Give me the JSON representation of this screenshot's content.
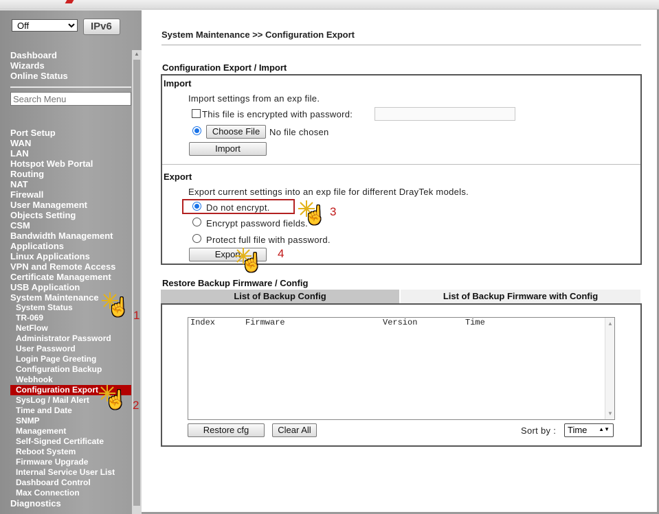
{
  "sidebar": {
    "mode_select_value": "Off",
    "ipv6_logo_text": "IPv6",
    "top_links": [
      "Dashboard",
      "Wizards",
      "Online Status"
    ],
    "search_placeholder": "Search Menu",
    "main_items": [
      "Port Setup",
      "WAN",
      "LAN",
      "Hotspot Web Portal",
      "Routing",
      "NAT",
      "Firewall",
      "User Management",
      "Objects Setting",
      "CSM",
      "Bandwidth Management",
      "Applications",
      "Linux Applications",
      "VPN and Remote Access",
      "Certificate Management",
      "USB Application",
      "System Maintenance"
    ],
    "sub_items": [
      "System Status",
      "TR-069",
      "NetFlow",
      "Administrator Password",
      "User Password",
      "Login Page Greeting",
      "Configuration Backup",
      "Webhook",
      "Configuration Export",
      "SysLog / Mail Alert",
      "Time and Date",
      "SNMP",
      "Management",
      "Self-Signed Certificate",
      "Reboot System",
      "Firmware Upgrade",
      "Internal Service User List",
      "Dashboard Control",
      "Max Connection"
    ],
    "active_sub": "Configuration Export",
    "last_item": "Diagnostics"
  },
  "main": {
    "breadcrumb": "System Maintenance >> Configuration Export",
    "section_title": "Configuration Export / Import",
    "import": {
      "heading": "Import",
      "description": "Import settings from an exp file.",
      "encrypted_label": "This file is encrypted with password:",
      "choose_file_label": "Choose File",
      "no_file_text": "No file chosen",
      "import_button": "Import"
    },
    "export": {
      "heading": "Export",
      "description": "Export current settings into an exp file for different DrayTek models.",
      "option_no_encrypt": "Do not encrypt.",
      "option_encrypt_password": "Encrypt password fields.",
      "option_protect_full": "Protect full file with password.",
      "export_button": "Export"
    },
    "restore": {
      "title": "Restore Backup Firmware / Config",
      "tab_config": "List of Backup Config",
      "tab_firmware": "List of Backup Firmware with Config",
      "columns": [
        "Index",
        "Firmware",
        "Version",
        "Time"
      ],
      "restore_button": "Restore cfg",
      "clear_button": "Clear All",
      "sort_label": "Sort by :",
      "sort_value": "Time"
    }
  },
  "callouts": [
    "1",
    "2",
    "3",
    "4"
  ],
  "colors": {
    "active_nav": "#b30000",
    "callout": "#c01818",
    "sidebar_bg": "#9c9c9c"
  }
}
